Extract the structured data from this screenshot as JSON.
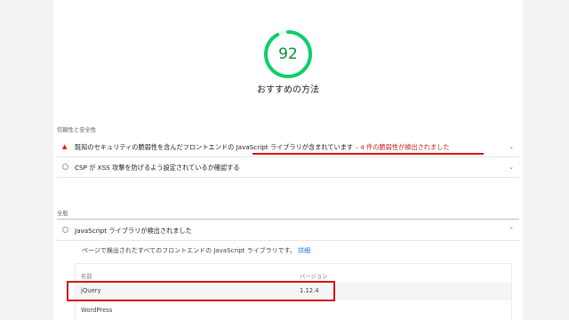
{
  "score": {
    "value": 92,
    "title": "おすすめの方法"
  },
  "colors": {
    "gauge": "#0cce6b",
    "fail": "#eb0f00",
    "accent_red": "#d21313",
    "link": "#1a73e8"
  },
  "sections": {
    "trust_safety": {
      "label": "信頼性と安全性",
      "audits": [
        {
          "icon": "warning-triangle-icon",
          "marker": "▲",
          "title": "既知のセキュリティの脆弱性を含んだフロントエンドの JavaScript ライブラリが含まれています",
          "detail": " – 4 件の脆弱性が検出されました"
        },
        {
          "icon": "pass-circle-icon",
          "title": "CSP が XSS 攻撃を防げるよう設定されているか確認する"
        }
      ]
    },
    "general": {
      "label": "全般",
      "audits": [
        {
          "icon": "pass-circle-icon",
          "title": "JavaScript ライブラリが検出されました",
          "description": "ページで検出されたすべてのフロントエンドの JavaScript ライブラリです。",
          "link_text": "詳細",
          "table": {
            "headers": [
              "名前",
              "バージョン"
            ],
            "rows": [
              [
                "jQuery",
                "1.12.4"
              ],
              [
                "WordPress",
                ""
              ]
            ]
          }
        }
      ]
    }
  }
}
